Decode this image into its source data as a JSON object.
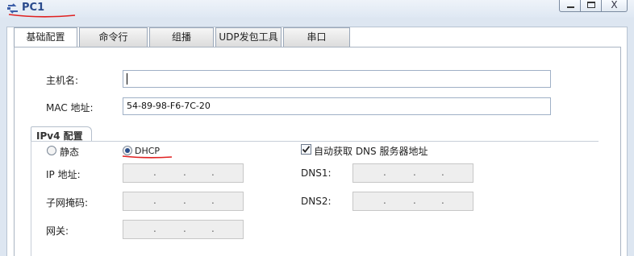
{
  "window": {
    "title": "PC1",
    "controls": {
      "minimize": "—",
      "maximize": "☐",
      "close": "X"
    }
  },
  "tabs": [
    {
      "label": "基础配置",
      "active": true
    },
    {
      "label": "命令行",
      "active": false
    },
    {
      "label": "组播",
      "active": false
    },
    {
      "label": "UDP发包工具",
      "active": false
    },
    {
      "label": "串口",
      "active": false
    }
  ],
  "basic": {
    "hostname_label": "主机名:",
    "hostname_value": "",
    "mac_label": "MAC 地址:",
    "mac_value": "54-89-98-F6-7C-20"
  },
  "ipv4": {
    "group_title": "IPv4 配置",
    "static_label": "静态",
    "dhcp_label": "DHCP",
    "mode": "DHCP",
    "auto_dns_label": "自动获取 DNS 服务器地址",
    "auto_dns_checked": true,
    "ip_label": "IP 地址:",
    "mask_label": "子网掩码:",
    "gateway_label": "网关:",
    "dns1_label": "DNS1:",
    "dns2_label": "DNS2:",
    "ip_dots": [
      ".",
      ".",
      "."
    ]
  },
  "colors": {
    "title_text": "#2a4a8c",
    "annotation_red": "#e02020",
    "radio_selected": "#2c4f8a"
  }
}
